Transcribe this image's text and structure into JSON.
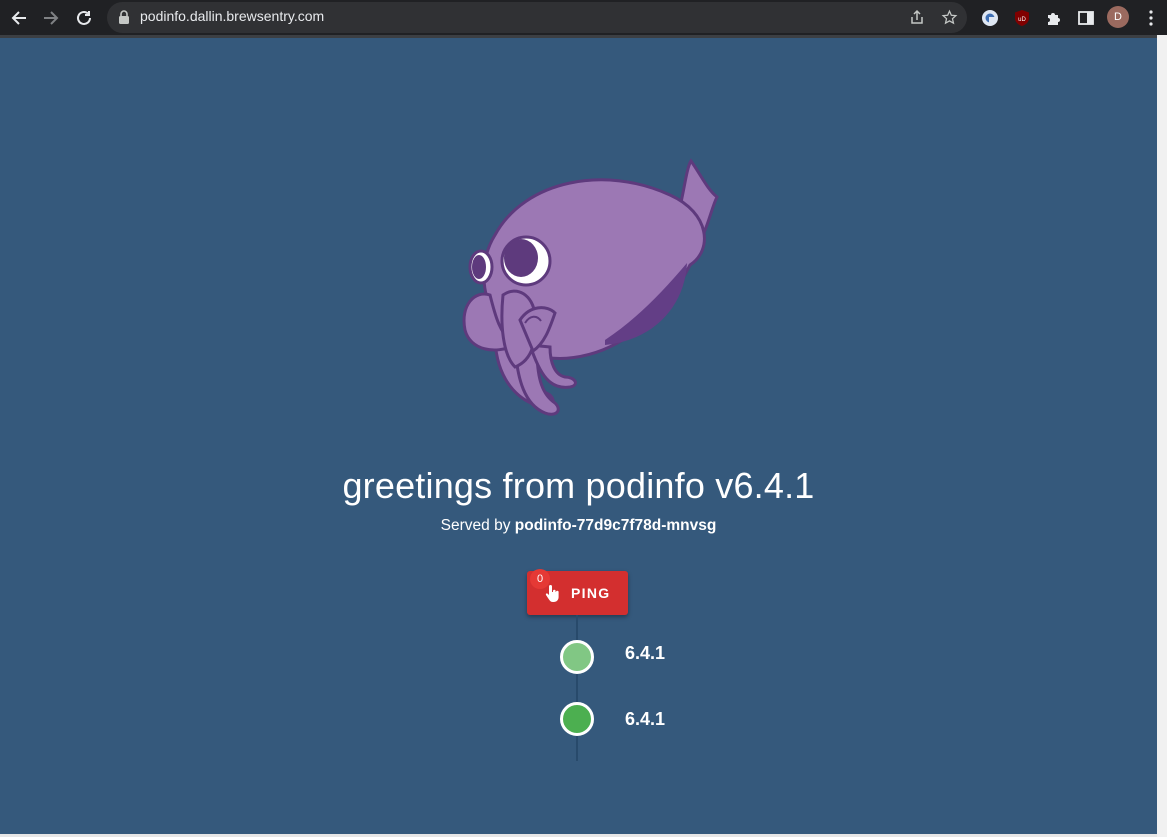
{
  "browser": {
    "url": "podinfo.dallin.brewsentry.com",
    "avatar_initial": "D"
  },
  "page": {
    "title": "greetings from podinfo v6.4.1",
    "served_prefix": "Served by",
    "pod_name": "podinfo-77d9c7f78d-mnvsg",
    "ping_label": "PING",
    "ping_count": "0",
    "timeline": [
      {
        "version": "6.4.1",
        "color": "#81c784"
      },
      {
        "version": "6.4.1",
        "color": "#4caf50"
      }
    ]
  },
  "colors": {
    "background": "#35597c",
    "ping_button": "#d32f2f",
    "mascot": "#9c78b4"
  }
}
